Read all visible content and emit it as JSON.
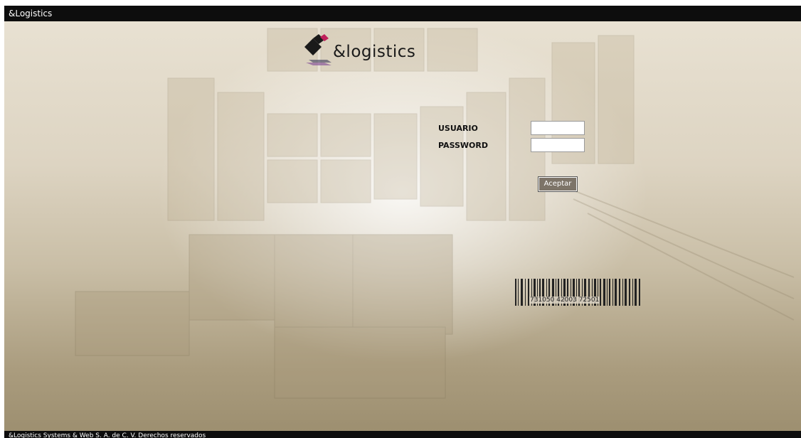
{
  "window": {
    "title": "&Logistics"
  },
  "logo": {
    "text": "&logistics"
  },
  "login": {
    "user_label": "USUARIO",
    "password_label": "PASSWORD",
    "user_value": "",
    "password_value": "",
    "submit_label": "Aceptar"
  },
  "barcode": {
    "number": "731050 42003 72501"
  },
  "footer": {
    "text": "&Logistics  Systems & Web   S. A. de C. V.  Derechos reservados"
  },
  "colors": {
    "titlebar": "#0d0d0d",
    "button": "#7d7468",
    "background_top": "#e8e1d2",
    "background_bottom": "#9d8f70"
  },
  "icons": {
    "logo_mark": "diamond-logo-icon",
    "barcode": "barcode-icon"
  }
}
